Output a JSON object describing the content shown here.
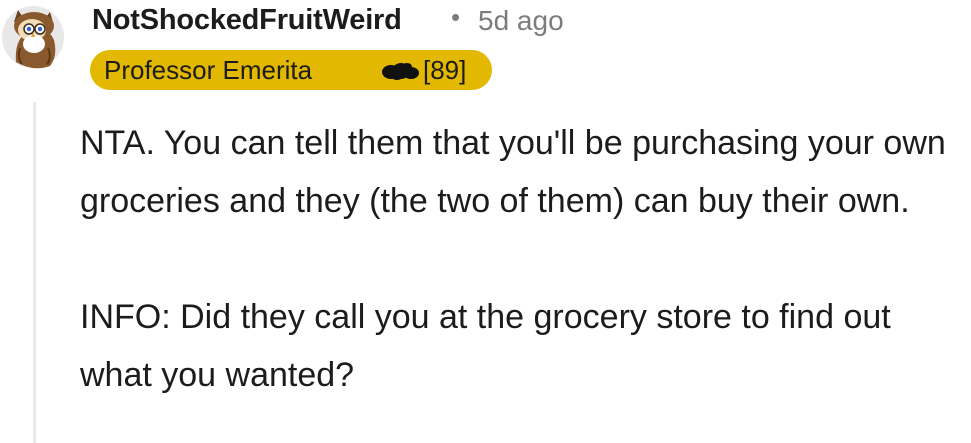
{
  "comment": {
    "author": "NotShockedFruitWeird",
    "separator": "•",
    "timestamp": "5d ago",
    "flair": {
      "label": "Professor Emerita",
      "count": "[89]",
      "background_color": "#e3b800"
    },
    "avatar_icon": "snoo-owl-avatar-icon",
    "paragraphs": [
      "NTA. You can tell them that you'll be purchasing your own groceries and they (the two of them) can buy their own.",
      "INFO: Did they call you at the grocery store to find out what you wanted?"
    ]
  }
}
